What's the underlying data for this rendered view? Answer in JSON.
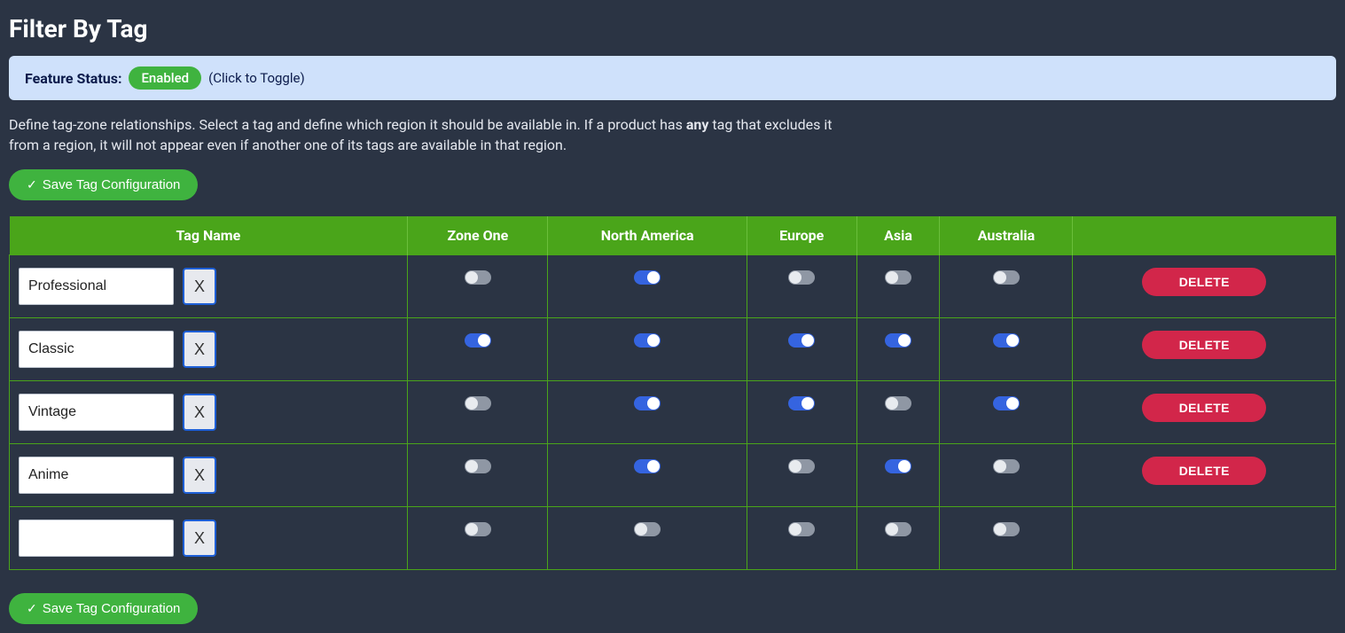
{
  "page": {
    "title": "Filter By Tag"
  },
  "status": {
    "label": "Feature Status:",
    "value": "Enabled",
    "hint": "(Click to Toggle)"
  },
  "description": {
    "pre": "Define tag-zone relationships. Select a tag and define which region it should be available in. If a product has ",
    "emph": "any",
    "post": " tag that excludes it from a region, it will not appear even if another one of its tags are available in that region."
  },
  "buttons": {
    "save_label": "Save Tag Configuration",
    "delete_label": "DELETE",
    "clear_label": "X",
    "check_glyph": "✓"
  },
  "table": {
    "headers": {
      "tag_name": "Tag Name",
      "zones": [
        "Zone One",
        "North America",
        "Europe",
        "Asia",
        "Australia"
      ]
    },
    "rows": [
      {
        "tag": "Professional",
        "zones": [
          false,
          true,
          false,
          false,
          false
        ],
        "has_delete": true
      },
      {
        "tag": "Classic",
        "zones": [
          true,
          true,
          true,
          true,
          true
        ],
        "has_delete": true
      },
      {
        "tag": "Vintage",
        "zones": [
          false,
          true,
          true,
          false,
          true
        ],
        "has_delete": true
      },
      {
        "tag": "Anime",
        "zones": [
          false,
          true,
          false,
          true,
          false
        ],
        "has_delete": true
      },
      {
        "tag": "",
        "zones": [
          false,
          false,
          false,
          false,
          false
        ],
        "has_delete": false
      }
    ]
  }
}
